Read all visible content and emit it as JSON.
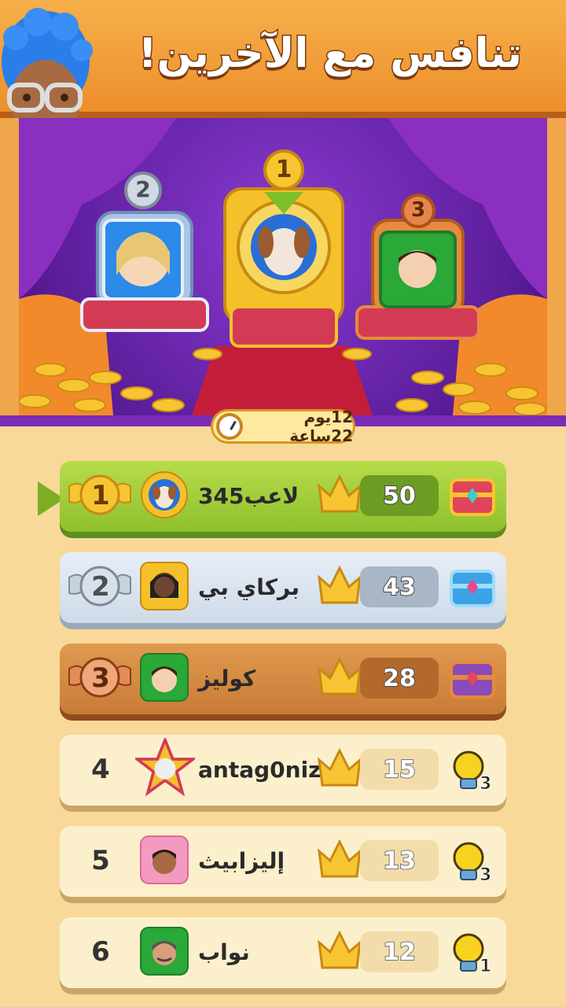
{
  "header": {
    "title": "تنافس مع الآخرين!"
  },
  "timer": {
    "label": "12يوم 22ساعة"
  },
  "podium": [
    {
      "rank": "1"
    },
    {
      "rank": "2"
    },
    {
      "rank": "3"
    }
  ],
  "rows": [
    {
      "rank": "1",
      "name": "لاعب345",
      "score": "50",
      "reward": "red-chest-icon"
    },
    {
      "rank": "2",
      "name": "بركاي بي",
      "score": "43",
      "reward": "blue-chest-icon"
    },
    {
      "rank": "3",
      "name": "كوليز",
      "score": "28",
      "reward": "purple-chest-icon"
    },
    {
      "rank": "4",
      "name": "antag0niz",
      "score": "15",
      "reward": "lightbulb-icon",
      "bulbs": "3"
    },
    {
      "rank": "5",
      "name": "إليزابيث",
      "score": "13",
      "reward": "lightbulb-icon",
      "bulbs": "3"
    },
    {
      "rank": "6",
      "name": "نواب",
      "score": "12",
      "reward": "lightbulb-icon",
      "bulbs": "1"
    }
  ]
}
